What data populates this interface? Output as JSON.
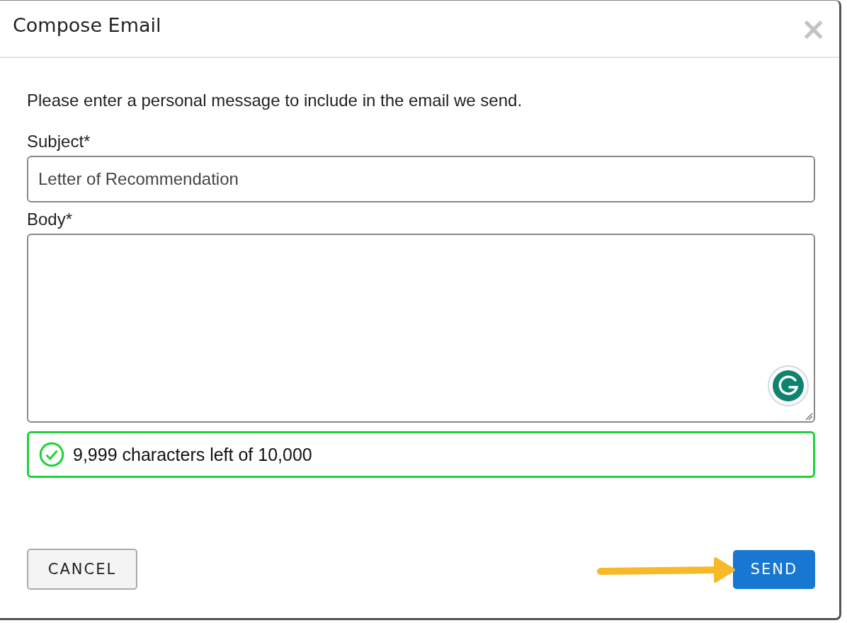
{
  "dialog": {
    "title": "Compose Email",
    "close": "×"
  },
  "intro": "Please enter a personal message to include in the email we send.",
  "subject": {
    "label": "Subject*",
    "value": "Letter of Recommendation"
  },
  "body": {
    "label": "Body*"
  },
  "counter": {
    "text": "9,999 characters left of 10,000",
    "valid": true
  },
  "buttons": [
    {
      "label": "CANCEL",
      "kind": "secondary"
    },
    {
      "label": "SEND",
      "kind": "primary"
    }
  ],
  "annotation": {
    "kind": "arrow"
  }
}
